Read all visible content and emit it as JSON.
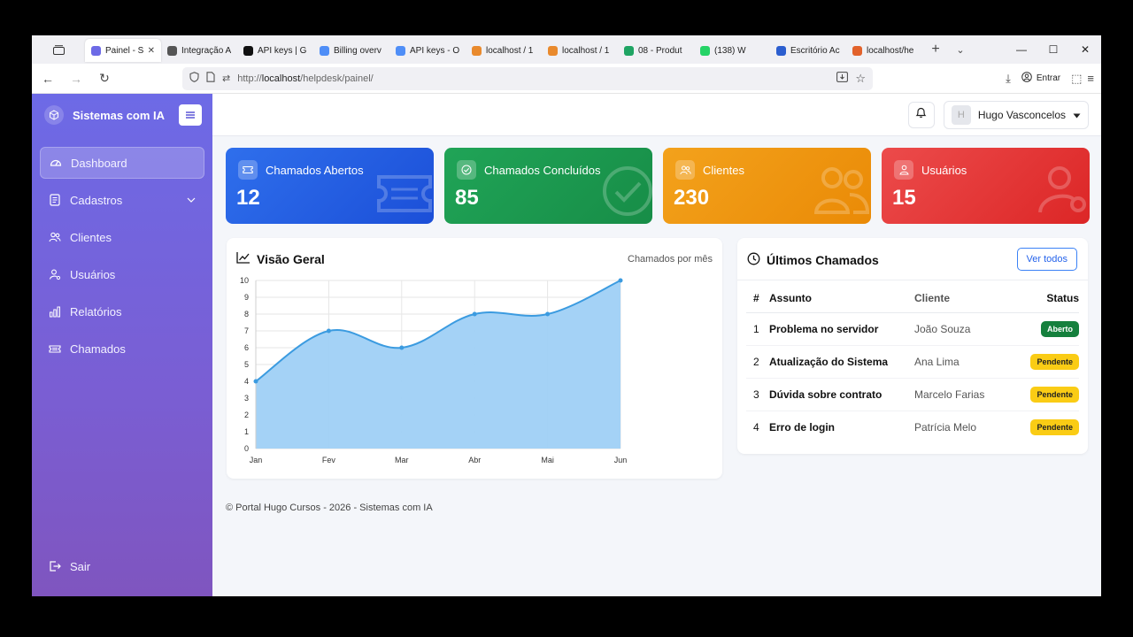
{
  "browser": {
    "tabs": [
      {
        "label": "Painel - S",
        "color": "#6d6ae6",
        "active": true
      },
      {
        "label": "Integração A",
        "color": "#555555"
      },
      {
        "label": "API keys | G",
        "color": "#111111"
      },
      {
        "label": "Billing overv",
        "color": "#4f8ef7"
      },
      {
        "label": "API keys - O",
        "color": "#4f8ef7"
      },
      {
        "label": "localhost / 1",
        "color": "#e98a2d"
      },
      {
        "label": "localhost / 1",
        "color": "#e98a2d"
      },
      {
        "label": "08 - Produt",
        "color": "#1fa463"
      },
      {
        "label": "(138) W",
        "color": "#25d366"
      },
      {
        "label": "Escritório Ac",
        "color": "#2b5ecf"
      },
      {
        "label": "localhost/he",
        "color": "#e2622b"
      }
    ],
    "url_prefix": "http://",
    "url_host": "localhost",
    "url_path": "/helpdesk/painel/",
    "entrar": "Entrar"
  },
  "sidebar": {
    "brand": "Sistemas com IA",
    "items": [
      {
        "label": "Dashboard"
      },
      {
        "label": "Cadastros"
      },
      {
        "label": "Clientes"
      },
      {
        "label": "Usuários"
      },
      {
        "label": "Relatórios"
      },
      {
        "label": "Chamados"
      }
    ],
    "logout": "Sair"
  },
  "topbar": {
    "avatar_initial": "H",
    "user_name": "Hugo Vasconcelos"
  },
  "cards": [
    {
      "label": "Chamados Abertos",
      "value": "12"
    },
    {
      "label": "Chamados Concluídos",
      "value": "85"
    },
    {
      "label": "Clientes",
      "value": "230"
    },
    {
      "label": "Usuários",
      "value": "15"
    }
  ],
  "overview": {
    "title": "Visão Geral",
    "subtitle": "Chamados por mês"
  },
  "chart_data": {
    "type": "area",
    "categories": [
      "Jan",
      "Fev",
      "Mar",
      "Abr",
      "Mai",
      "Jun"
    ],
    "values": [
      4,
      7,
      6,
      8,
      8,
      10
    ],
    "ylim": [
      0,
      10
    ],
    "yticks": [
      "0",
      "1",
      "2",
      "3",
      "4",
      "5",
      "6",
      "7",
      "8",
      "9",
      "10"
    ],
    "grid": true,
    "line_color": "#3b9be0",
    "fill_color": "#9fd0f5"
  },
  "tickets": {
    "title": "Últimos Chamados",
    "view_all": "Ver todos",
    "headers": {
      "num": "#",
      "subject": "Assunto",
      "client": "Cliente",
      "status": "Status"
    },
    "rows": [
      {
        "num": "1",
        "subject": "Problema no servidor",
        "client": "João Souza",
        "status": "Aberto"
      },
      {
        "num": "2",
        "subject": "Atualização do Sistema",
        "client": "Ana Lima",
        "status": "Pendente"
      },
      {
        "num": "3",
        "subject": "Dúvida sobre contrato",
        "client": "Marcelo Farias",
        "status": "Pendente"
      },
      {
        "num": "4",
        "subject": "Erro de login",
        "client": "Patrícia Melo",
        "status": "Pendente"
      }
    ]
  },
  "footer": "© Portal Hugo Cursos - 2026 - Sistemas com IA"
}
